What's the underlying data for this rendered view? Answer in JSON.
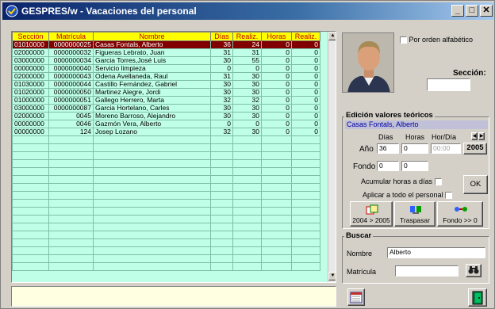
{
  "window": {
    "title": "GESPRES/w - Vacaciones del personal",
    "minimize": "_",
    "maximize": "□",
    "close": "✕"
  },
  "grid": {
    "columns": [
      "Sección",
      "Matrícula",
      "Nombre",
      "Días",
      "Realiz.",
      "Horas",
      "Realiz."
    ],
    "rows": [
      {
        "seccion": "01010000",
        "matricula": "0000000025",
        "nombre": "Casas Fontals, Alberto",
        "dias": "36",
        "realiz": "24",
        "horas": "0",
        "realiz2": "0",
        "selected": true
      },
      {
        "seccion": "02000000",
        "matricula": "0000000032",
        "nombre": "Figueras Lebrato, Juan",
        "dias": "31",
        "realiz": "31",
        "horas": "0",
        "realiz2": "0"
      },
      {
        "seccion": "03000000",
        "matricula": "0000000034",
        "nombre": "Garcia Torres,José Luis",
        "dias": "30",
        "realiz": "55",
        "horas": "0",
        "realiz2": "0"
      },
      {
        "seccion": "00000000",
        "matricula": "0000000040",
        "nombre": "Servicio limpieza",
        "dias": "0",
        "realiz": "0",
        "horas": "0",
        "realiz2": "0"
      },
      {
        "seccion": "02000000",
        "matricula": "0000000043",
        "nombre": "Odena Avellaneda, Raul",
        "dias": "31",
        "realiz": "30",
        "horas": "0",
        "realiz2": "0"
      },
      {
        "seccion": "01030000",
        "matricula": "0000000044",
        "nombre": "Castillo Fernández, Gabriel",
        "dias": "30",
        "realiz": "30",
        "horas": "0",
        "realiz2": "0"
      },
      {
        "seccion": "01020000",
        "matricula": "0000000050",
        "nombre": "Martinez Alegre, Jordi",
        "dias": "30",
        "realiz": "30",
        "horas": "0",
        "realiz2": "0"
      },
      {
        "seccion": "01000000",
        "matricula": "0000000051",
        "nombre": "Gallego Herrero, Marta",
        "dias": "32",
        "realiz": "32",
        "horas": "0",
        "realiz2": "0"
      },
      {
        "seccion": "03000000",
        "matricula": "0000000087",
        "nombre": "Garcia Hortelano, Carles",
        "dias": "30",
        "realiz": "30",
        "horas": "0",
        "realiz2": "0"
      },
      {
        "seccion": "02000000",
        "matricula": "0045",
        "nombre": "Moreno Barroso, Alejandro",
        "dias": "30",
        "realiz": "30",
        "horas": "0",
        "realiz2": "0"
      },
      {
        "seccion": "00000000",
        "matricula": "0046",
        "nombre": "Gazmón Vera, Alberto",
        "dias": "0",
        "realiz": "0",
        "horas": "0",
        "realiz2": "0"
      },
      {
        "seccion": "00000000",
        "matricula": "124",
        "nombre": "Josep Lozano",
        "dias": "32",
        "realiz": "30",
        "horas": "0",
        "realiz2": "0"
      }
    ],
    "empty_rows": 17
  },
  "sidebar": {
    "por_orden_label": "Por orden alfabético",
    "seccion_label": "Sección:",
    "seccion_value": ""
  },
  "edicion": {
    "title": "Edición valores teóricos",
    "employee": "Casas Fontals, Alberto",
    "dias_label": "Días",
    "horas_label": "Horas",
    "hordia_label": "Hor/Día",
    "ano_label": "Año",
    "ano_dias": "36",
    "ano_horas": "0",
    "ano_hordia": "00:00",
    "year": "2005",
    "fondo_label": "Fondo",
    "fondo_dias": "0",
    "fondo_horas": "0",
    "acumular_label": "Acumular horas a días",
    "aplicar_label": "Aplicar a todo el personal",
    "ok_label": "OK",
    "btn_year": "2004 > 2005",
    "btn_traspasar": "Traspasar",
    "btn_fondo": "Fondo >> 0"
  },
  "buscar": {
    "title": "Buscar",
    "nombre_label": "Nombre",
    "nombre_value": "Alberto",
    "matricula_label": "Matrícula",
    "matricula_value": ""
  },
  "colors": {
    "header_bg": "#ffff00",
    "header_text": "#c00000",
    "grid_bg": "#bfffe8",
    "selected_row": "#800000",
    "link_text": "#0000a0"
  }
}
